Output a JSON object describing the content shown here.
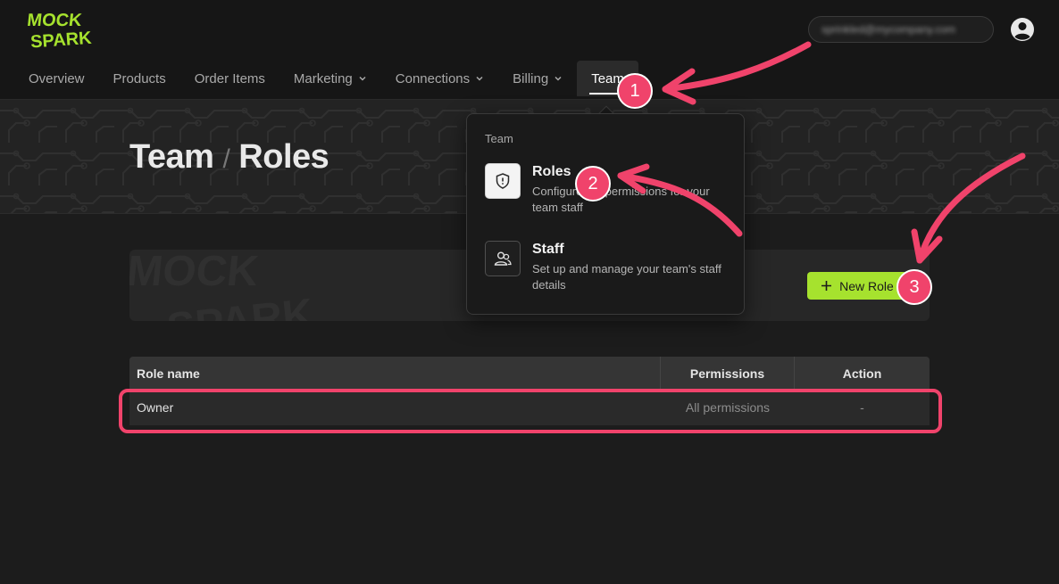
{
  "brand": {
    "logo_line1": "MOCK",
    "logo_line2": "SPARK",
    "accent_color": "#a6e22e"
  },
  "account": {
    "label": "sprinkled@mycompany.com"
  },
  "nav": {
    "items": [
      {
        "label": "Overview",
        "has_dropdown": false,
        "active": false
      },
      {
        "label": "Products",
        "has_dropdown": false,
        "active": false
      },
      {
        "label": "Order Items",
        "has_dropdown": false,
        "active": false
      },
      {
        "label": "Marketing",
        "has_dropdown": true,
        "active": false
      },
      {
        "label": "Connections",
        "has_dropdown": true,
        "active": false
      },
      {
        "label": "Billing",
        "has_dropdown": true,
        "active": false
      },
      {
        "label": "Team",
        "has_dropdown": false,
        "active": true
      }
    ]
  },
  "page": {
    "breadcrumb_parent": "Team",
    "breadcrumb_separator": "/",
    "breadcrumb_current": "Roles"
  },
  "toolbar": {
    "new_role_label": "New Role"
  },
  "dropdown": {
    "heading": "Team",
    "items": [
      {
        "title": "Roles",
        "description": "Configure the permissions for your team staff",
        "icon": "shield-icon"
      },
      {
        "title": "Staff",
        "description": "Set up and manage your team's staff details",
        "icon": "users-icon"
      }
    ]
  },
  "table": {
    "columns": [
      "Role name",
      "Permissions",
      "Action"
    ],
    "rows": [
      {
        "role_name": "Owner",
        "permissions": "All permissions",
        "action": "-"
      }
    ]
  },
  "annotations": {
    "marker_color": "#f0436b",
    "markers": [
      "1",
      "2",
      "3"
    ]
  }
}
